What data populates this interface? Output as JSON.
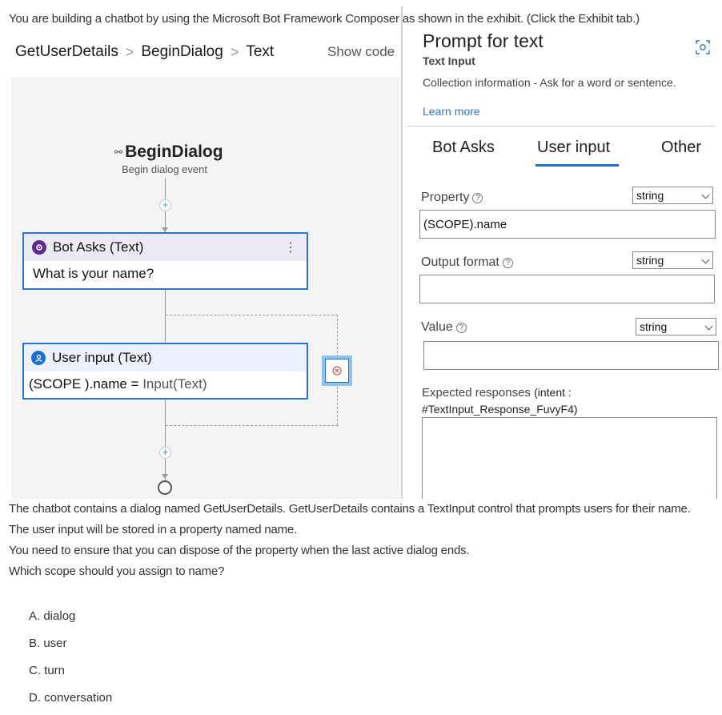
{
  "question": {
    "intro": "You are building a chatbot by using the Microsoft Bot Framework Composer as shown in the exhibit. (Click the Exhibit tab.)",
    "lines": [
      "The chatbot contains a dialog named GetUserDetails. GetUserDetails contains a TextInput control that prompts users for their name.",
      "The user input will be stored in a property named name.",
      "You need to ensure that you can dispose of the property when the last active dialog ends.",
      "Which scope should you assign to name?"
    ],
    "options": [
      "A. dialog",
      "B. user",
      "C. turn",
      "D. conversation"
    ]
  },
  "breadcrumb": {
    "items": [
      "GetUserDetails",
      "BeginDialog",
      "Text"
    ],
    "separator": ">",
    "show_code": "Show code"
  },
  "canvas": {
    "begin_icon": "⚯",
    "begin_title": "BeginDialog",
    "begin_subtitle": "Begin dialog event",
    "bot_asks": {
      "title": "Bot Asks (Text)",
      "body": "What is your name?",
      "menu": "⋮"
    },
    "user_input": {
      "title": "User input (Text)",
      "body_prefix": "(SCOPE ).name",
      "body_op": " = ",
      "body_value": "Input(Text)"
    }
  },
  "panel": {
    "title": "Prompt for text",
    "subtitle": "Text Input",
    "description": "Collection information - Ask for a word or sentence.",
    "learn_more": "Learn more",
    "tabs": [
      "Bot Asks",
      "User input",
      "Other"
    ],
    "active_tab": 1,
    "property": {
      "label": "Property",
      "type": "string",
      "value": "(SCOPE).name"
    },
    "output_format": {
      "label": "Output format",
      "type": "string",
      "value": ""
    },
    "value": {
      "label": "Value",
      "type": "string",
      "value": ""
    },
    "expected": {
      "label": "Expected responses",
      "intent_label": "(intent :",
      "intent_value": "#TextInput_Response_FuvyF4)"
    },
    "help_glyph": "?"
  },
  "colors": {
    "accent": "#2c75c9",
    "tab_underline": "#1f6fd0",
    "bot_badge": "#5c2d91",
    "user_badge": "#1f6fd0",
    "canvas_bg": "#f4f4f4",
    "error": "#d9534f"
  }
}
